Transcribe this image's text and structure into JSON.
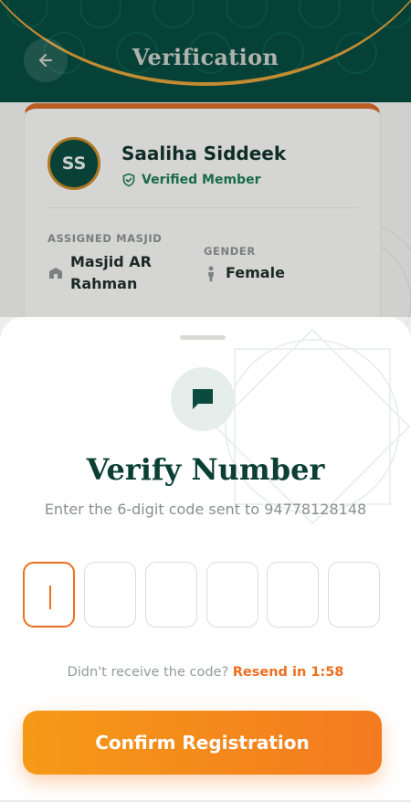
{
  "header": {
    "title": "Verification"
  },
  "profile": {
    "initials": "SS",
    "name": "Saaliha Siddeek",
    "status": "Verified Member",
    "masjid_label": "ASSIGNED MASJID",
    "masjid_value_line1": "Masjid AR",
    "masjid_value_line2": "Rahman",
    "gender_label": "GENDER",
    "gender_value": "Female"
  },
  "sheet": {
    "title": "Verify Number",
    "subtitle": "Enter the 6-digit code sent to 94778128148",
    "otp_digits": [
      "",
      "",
      "",
      "",
      "",
      ""
    ],
    "resend_prompt": "Didn't receive the code?",
    "resend_link": "Resend in 1:58",
    "confirm_label": "Confirm Registration"
  },
  "colors": {
    "header_bg": "#064a3f",
    "accent_orange": "#ef6e1e",
    "button_gradient_start": "#f59a17",
    "button_gradient_end": "#f47a1f",
    "verified_green": "#1e7a52",
    "title_dark_green": "#0c3f34"
  },
  "icons": {
    "back": "arrow-left-icon",
    "verified": "shield-check-icon",
    "masjid": "mosque-icon",
    "gender": "person-icon",
    "message": "chat-bubble-icon"
  }
}
